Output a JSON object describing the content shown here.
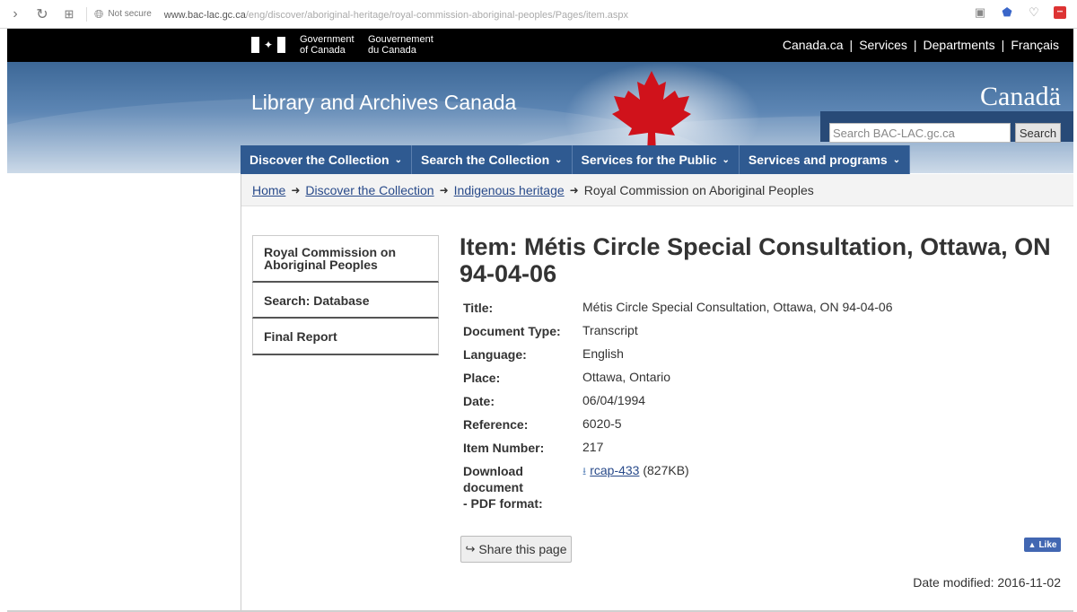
{
  "browser": {
    "security_label": "Not secure",
    "url_domain": "www.bac-lac.gc.ca",
    "url_path": "/eng/discover/aboriginal-heritage/royal-commission-aboriginal-peoples/Pages/item.aspx"
  },
  "fip": {
    "gov_en_line1": "Government",
    "gov_en_line2": "of Canada",
    "gov_fr_line1": "Gouvernement",
    "gov_fr_line2": "du Canada",
    "links": [
      "Canada.ca",
      "Services",
      "Departments",
      "Français"
    ]
  },
  "banner": {
    "site_title": "Library and Archives Canada",
    "wordmark": "Canadä",
    "search_placeholder": "Search BAC-LAC.gc.ca",
    "search_button": "Search"
  },
  "menu": [
    {
      "label": "Discover the Collection"
    },
    {
      "label": "Search the Collection"
    },
    {
      "label": "Services for the Public"
    },
    {
      "label": "Services and programs"
    }
  ],
  "breadcrumb": {
    "home": "Home",
    "level1": "Discover the Collection",
    "level2": "Indigenous heritage",
    "current": "Royal Commission on Aboriginal Peoples"
  },
  "secnav": [
    {
      "label_line1": "Royal Commission on",
      "label_line2": "Aboriginal Peoples"
    },
    {
      "label": "Search: Database"
    },
    {
      "label": "Final Report"
    }
  ],
  "item": {
    "heading": "Item: Métis Circle Special Consultation, Ottawa, ON 94-04-06",
    "fields": [
      {
        "label": "Title:",
        "value": "Métis Circle Special Consultation, Ottawa, ON 94-04-06"
      },
      {
        "label": "Document Type:",
        "value": "Transcript"
      },
      {
        "label": "Language:",
        "value": "English"
      },
      {
        "label": "Place:",
        "value": "Ottawa, Ontario"
      },
      {
        "label": "Date:",
        "value": "06/04/1994"
      },
      {
        "label": "Reference:",
        "value": "6020-5"
      },
      {
        "label": "Item Number:",
        "value": "217"
      }
    ],
    "download_label_line1": "Download document",
    "download_label_line2": "- PDF format:",
    "download_link": "rcap-433",
    "download_size": "(827KB)"
  },
  "share_label": "Share this page",
  "like_label": "Like",
  "date_modified_label": "Date modified:",
  "date_modified_value": "2016-11-02"
}
